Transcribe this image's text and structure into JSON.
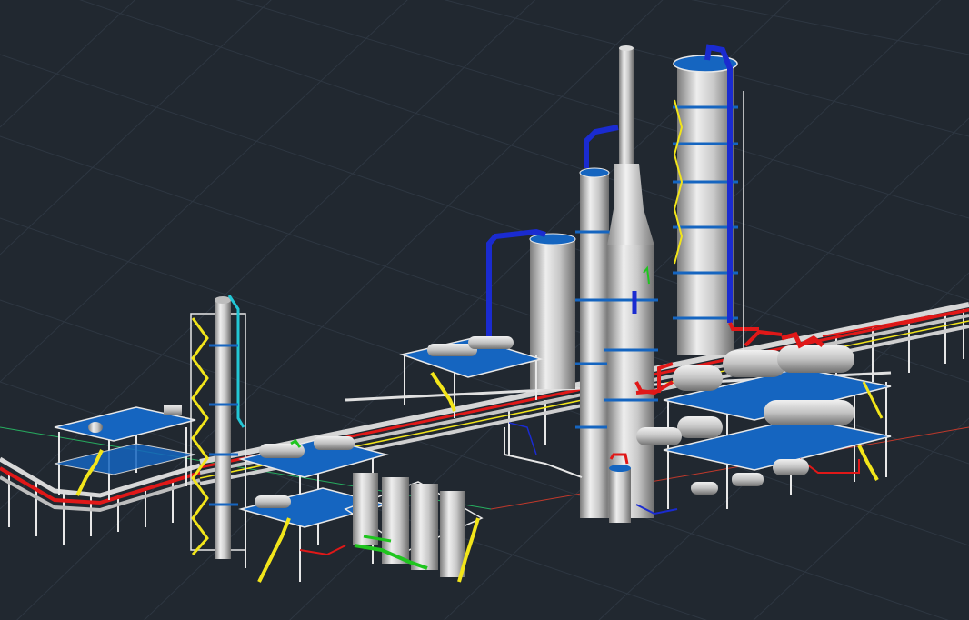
{
  "viewport": {
    "background": "#212830",
    "grid_color": "#2e3742",
    "visual_style": "shaded",
    "label_text": ""
  },
  "scene": {
    "objects": [
      "distillation-column-tall",
      "distillation-column-medium",
      "vent-stack",
      "vertical-vessel",
      "receiver-drum",
      "thin-column-left",
      "main-pipe-rack",
      "left-pipe-rack",
      "heat-exchanger-structure-right",
      "heat-exchanger-structure-left",
      "pump-platform-left",
      "tank-farm",
      "stairs"
    ],
    "colors": {
      "equipment": "#c9c9c9",
      "platform_floor": "#1565c0",
      "steel_structure": "#e8e8e8",
      "handrail": "#f2e51a",
      "vapor_line": "#1a2bd0",
      "hot_line": "#e01818",
      "water_line": "#1fc51f",
      "cyan_line": "#22c7d6"
    }
  },
  "ucs_axis": {
    "x_color": "#c0392b",
    "y_color": "#27ae60"
  }
}
